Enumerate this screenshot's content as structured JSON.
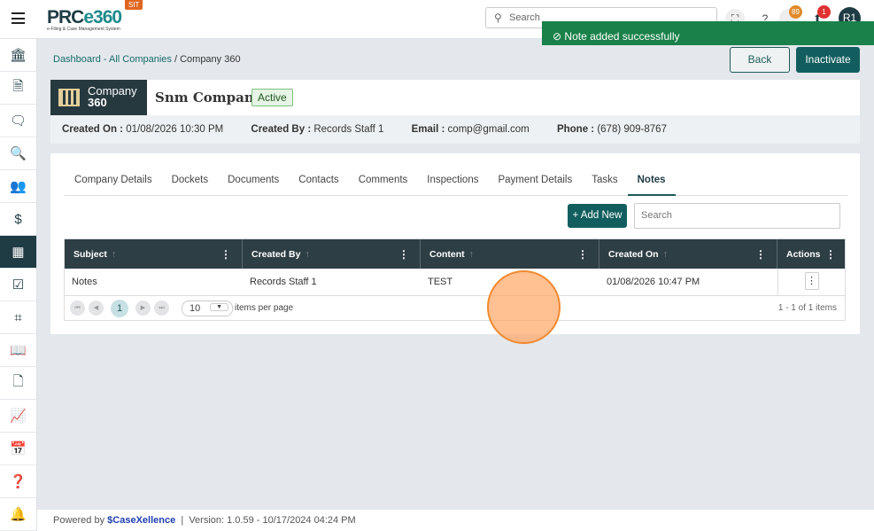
{
  "app": {
    "logo_main": "PRC",
    "logo_accent": "e360",
    "logo_sub": "e-Filing & Case Management System",
    "env_badge": "SIT"
  },
  "topbar": {
    "search_placeholder": "Search",
    "notif_count": "89",
    "alert_count": "1",
    "avatar": "R1"
  },
  "toast": {
    "message": "Note added successfully"
  },
  "sidebar": {
    "items": [
      "bank-icon",
      "document-icon",
      "comment-icon",
      "search-document-icon",
      "users-icon",
      "dollar-document-icon",
      "company-icon",
      "task-icon",
      "scan-icon",
      "book-icon",
      "file-icon",
      "chart-icon",
      "calendar-icon",
      "help-book-icon",
      "alarm-icon"
    ],
    "active": 6
  },
  "breadcrumb": {
    "dashboard": "Dashboard",
    "companies": "All Companies",
    "current": "Company 360",
    "sep": " - ",
    "sep2": " / "
  },
  "actions": {
    "back": "Back",
    "inactivate": "Inactivate"
  },
  "company": {
    "box_line1": "Company",
    "box_line2": "360",
    "name": "Snm Company",
    "status": "Active",
    "created_on_label": "Created On :",
    "created_on": "01/08/2026 10:30 PM",
    "created_by_label": "Created By :",
    "created_by": "Records Staff 1",
    "email_label": "Email :",
    "email": "comp@gmail.com",
    "phone_label": "Phone :",
    "phone": "(678) 909-8767"
  },
  "tabs": [
    "Company Details",
    "Dockets",
    "Documents",
    "Contacts",
    "Comments",
    "Inspections",
    "Payment Details",
    "Tasks",
    "Notes"
  ],
  "active_tab": "Notes",
  "notes": {
    "add_new": "+ Add New",
    "search_placeholder": "Search",
    "columns": [
      "Subject",
      "Created By",
      "Content",
      "Created On",
      "Actions"
    ],
    "rows": [
      {
        "subject": "Notes",
        "created_by": "Records Staff 1",
        "content": "TEST",
        "created_on": "01/08/2026 10:47 PM"
      }
    ],
    "page": "1",
    "per_page": "10",
    "per_page_label": "items per page",
    "info": "1 - 1 of 1 items"
  },
  "footer": {
    "powered": "Powered by",
    "brand": "CaseXellence",
    "sep": "|",
    "version": "Version: 1.0.59 - 10/17/2024 04:24 PM"
  }
}
